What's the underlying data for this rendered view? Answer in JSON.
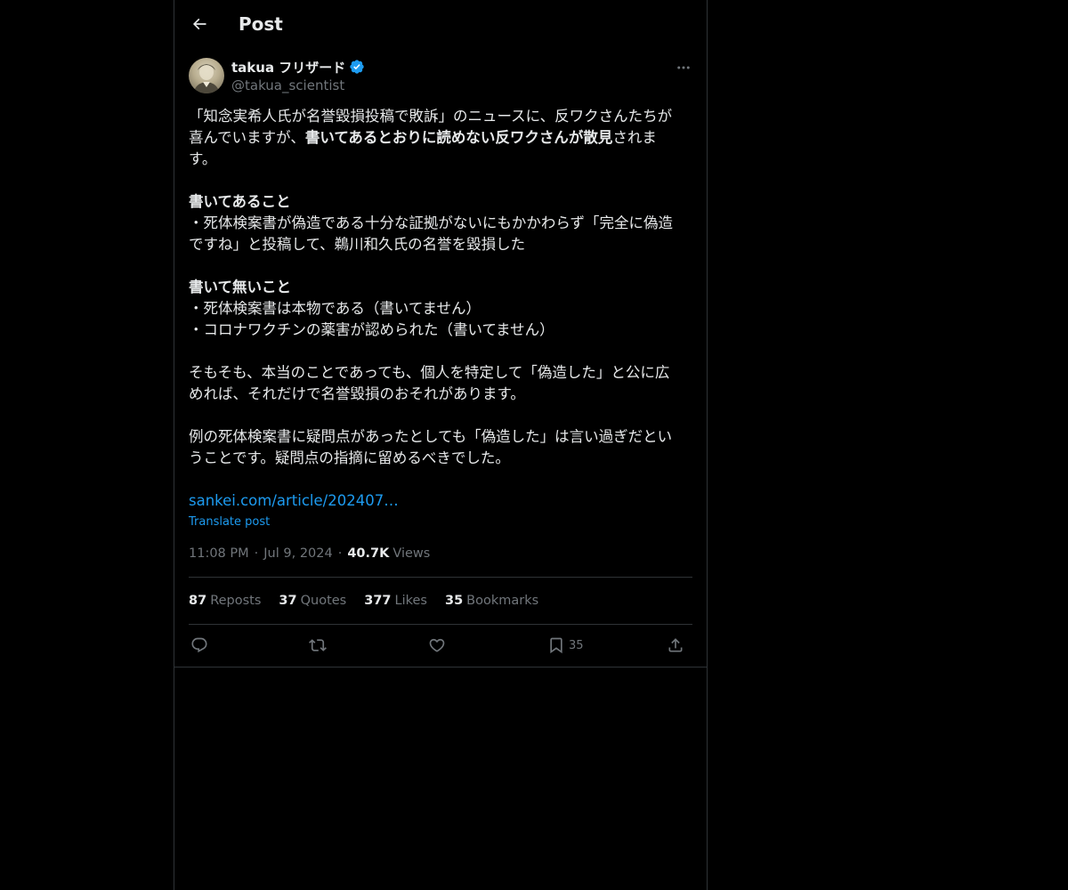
{
  "header": {
    "title": "Post",
    "back_icon": "arrow-left-icon"
  },
  "author": {
    "name": "takua フリザード",
    "handle": "@takua_scientist",
    "verified_color": "#1d9bf0"
  },
  "post": {
    "line1": "「知念実希人氏が名誉毀損投稿で敗訴」のニュースに、反ワクさんたちが",
    "line2_pre": "喜んでいますが、",
    "line2_bold": "書いてあるとおりに読めない反ワクさんが散見",
    "line2_post": "されま",
    "line3": "す。",
    "heading1": "書いてあること",
    "item1_line1": "・死体検案書が偽造である十分な証拠がないにもかかわらず「完全に偽造",
    "item1_line2": "ですね」と投稿して、鵜川和久氏の名誉を毀損した",
    "heading2": "書いて無いこと",
    "item2": "・死体検案書は本物である（書いてません）",
    "item3": "・コロナワクチンの薬害が認められた（書いてません）",
    "para1_line1": "そもそも、本当のことであっても、個人を特定して「偽造した」と公に広",
    "para1_line2": "めれば、それだけで名誉毀損のおそれがあります。",
    "para2_line1": "例の死体検案書に疑問点があったとしても「偽造した」は言い過ぎだとい",
    "para2_line2": "うことです。疑問点の指摘に留めるべきでした。",
    "link": "sankei.com/article/202407…",
    "translate": "Translate post"
  },
  "meta": {
    "time": "11:08 PM",
    "sep": "·",
    "date": "Jul 9, 2024",
    "views_count": "40.7K",
    "views_label": "Views"
  },
  "stats": {
    "reposts_count": "87",
    "reposts_label": "Reposts",
    "quotes_count": "37",
    "quotes_label": "Quotes",
    "likes_count": "377",
    "likes_label": "Likes",
    "bookmarks_count": "35",
    "bookmarks_label": "Bookmarks"
  },
  "actions": {
    "bookmark_count": "35"
  },
  "colors": {
    "background": "#000000",
    "text": "#e7e9ea",
    "muted": "#71767b",
    "accent": "#1d9bf0",
    "border": "#2f3336"
  }
}
